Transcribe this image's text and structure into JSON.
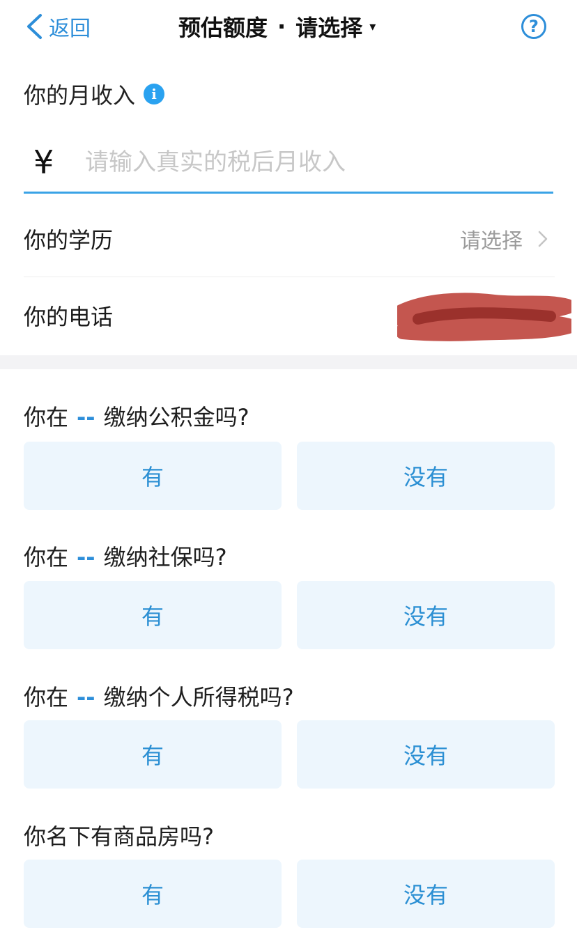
{
  "nav": {
    "back_label": "返回",
    "title_main": "预估额度",
    "title_sep": "·",
    "title_select": "请选择",
    "caret": "▾",
    "help_glyph": "?"
  },
  "income": {
    "label": "你的月收入",
    "info_glyph": "i",
    "currency": "¥",
    "placeholder": "请输入真实的税后月收入",
    "value": ""
  },
  "education": {
    "label": "你的学历",
    "value": "请选择"
  },
  "phone": {
    "label": "你的电话"
  },
  "questions": [
    {
      "prefix": "你在",
      "dash": "--",
      "text": "缴纳公积金吗?",
      "yes": "有",
      "no": "没有"
    },
    {
      "prefix": "你在",
      "dash": "--",
      "text": "缴纳社保吗?",
      "yes": "有",
      "no": "没有"
    },
    {
      "prefix": "你在",
      "dash": "--",
      "text": "缴纳个人所得税吗?",
      "yes": "有",
      "no": "没有"
    },
    {
      "text": "你名下有商品房吗?",
      "yes": "有",
      "no": "没有"
    }
  ],
  "colors": {
    "accent": "#2d8ed9",
    "option_bg": "#edf6fd",
    "underline": "#3aa3e6",
    "info": "#2aa2f0",
    "divider": "#f3f3f5"
  }
}
